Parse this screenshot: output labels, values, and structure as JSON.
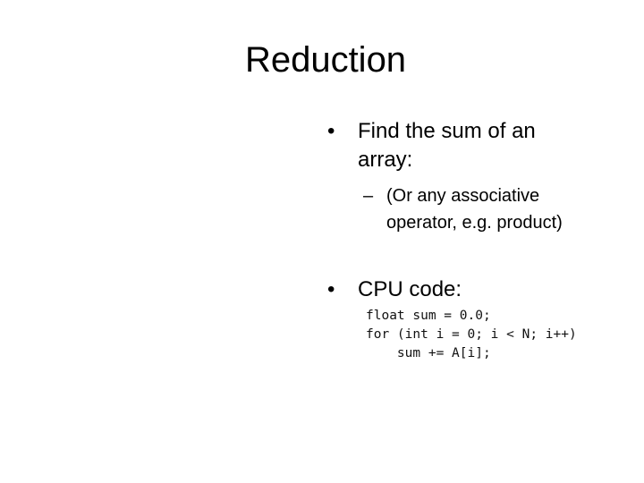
{
  "slide": {
    "title": "Reduction",
    "bullets": [
      {
        "marker": "•",
        "lines": [
          "Find the sum of an",
          "array:"
        ],
        "sub": {
          "marker": "–",
          "lines": [
            "(Or any associative",
            "operator, e.g. product)"
          ]
        }
      },
      {
        "marker": "•",
        "lines": [
          "CPU code:"
        ]
      }
    ],
    "code_lines": [
      "float sum = 0.0;",
      "for (int i = 0; i < N; i++)",
      "    sum += A[i];"
    ]
  }
}
